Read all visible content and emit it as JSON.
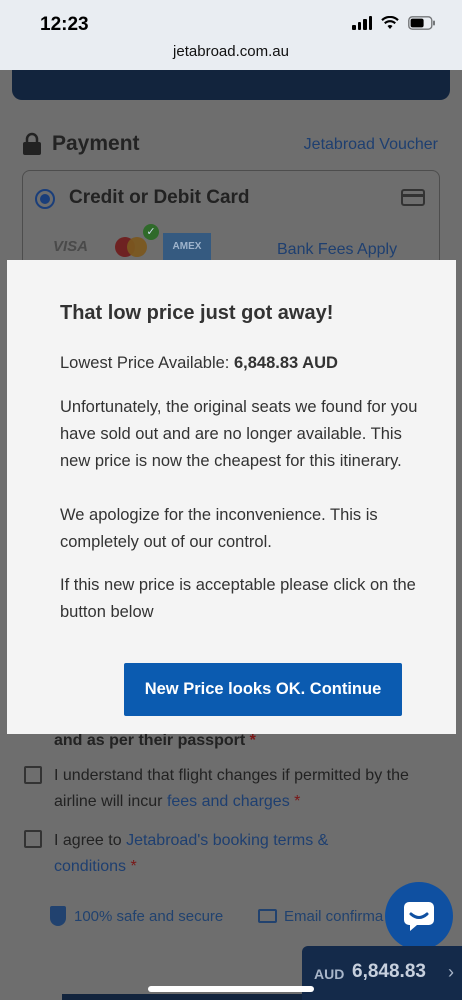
{
  "status_bar": {
    "time": "12:23",
    "url": "jetabroad.com.au"
  },
  "payment": {
    "title": "Payment",
    "voucher_link": "Jetabroad Voucher",
    "method_label": "Credit or Debit Card",
    "card_logos": {
      "visa": "VISA",
      "amex": "AMEX"
    },
    "bank_fees": "Bank Fees Apply"
  },
  "form": {
    "passport_note": "and as per their passport",
    "required_mark": "*",
    "flight_changes_text": "I understand that flight changes if permitted by the airline will incur",
    "flight_changes_link": "fees and charges",
    "terms_text": "I agree to",
    "terms_link": "Jetabroad's booking terms & conditions"
  },
  "trust": {
    "safe": "100% safe and secure",
    "email": "Email confirma"
  },
  "price_bar": {
    "currency": "AUD",
    "amount": "6,848.83"
  },
  "modal": {
    "title": "That low price just got away!",
    "price_label": "Lowest Price Available:",
    "price_value": "6,848.83 AUD",
    "paragraph1": "Unfortunately, the original seats we found for you have sold out and are no longer available. This new price is now the cheapest for this itinerary.",
    "paragraph2": "We apologize for the inconvenience. This is completely out of our control.",
    "paragraph3": "If this new price is acceptable please click on the button below",
    "button": "New Price looks OK. Continue"
  },
  "colors": {
    "accent": "#0b5bb0",
    "navy": "#12243d",
    "overlay": "#6e6e6e"
  }
}
